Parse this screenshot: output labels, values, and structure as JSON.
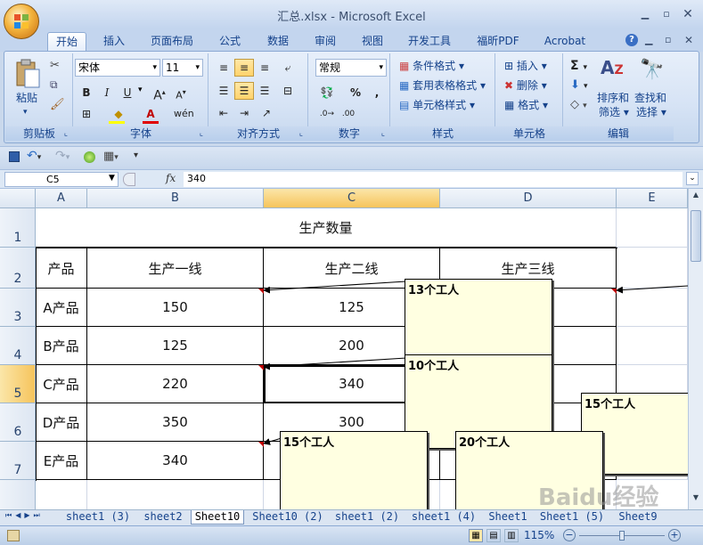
{
  "window": {
    "title": "汇总.xlsx - Microsoft Excel"
  },
  "ribbon_tabs": [
    "开始",
    "插入",
    "页面布局",
    "公式",
    "数据",
    "审阅",
    "视图",
    "开发工具",
    "福昕PDF",
    "Acrobat"
  ],
  "clipboard": {
    "paste": "粘贴",
    "label": "剪贴板"
  },
  "font": {
    "name": "宋体",
    "size": "11",
    "label": "字体"
  },
  "alignment": {
    "label": "对齐方式"
  },
  "number": {
    "format": "常规",
    "label": "数字"
  },
  "styles": {
    "conditional": "条件格式",
    "table": "套用表格格式",
    "cell": "单元格样式",
    "label": "样式"
  },
  "cells": {
    "insert": "插入",
    "delete": "删除",
    "format": "格式",
    "label": "单元格"
  },
  "editing": {
    "sort": "排序和",
    "filter": "筛选",
    "find": "查找和",
    "select": "选择",
    "label": "编辑"
  },
  "formula_bar": {
    "name_box": "C5",
    "fx": "fx",
    "value": "340"
  },
  "columns": [
    "A",
    "B",
    "C",
    "D",
    "E"
  ],
  "rows": [
    "1",
    "2",
    "3",
    "4",
    "5",
    "6",
    "7"
  ],
  "sheet": {
    "title": "生产数量",
    "headers": [
      "产品",
      "生产一线",
      "生产二线",
      "生产三线"
    ],
    "data": [
      [
        "A产品",
        "150",
        "125"
      ],
      [
        "B产品",
        "125",
        "200"
      ],
      [
        "C产品",
        "220",
        "340"
      ],
      [
        "D产品",
        "350",
        "300"
      ],
      [
        "E产品",
        "340",
        ""
      ]
    ]
  },
  "comments": [
    "13个工人",
    "10个工人",
    "15个工人",
    "15个工人",
    "20个工人"
  ],
  "sheet_tabs": [
    "sheet1 (3)",
    "sheet2",
    "Sheet10",
    "Sheet10 (2)",
    "sheet1 (2)",
    "sheet1 (4)",
    "Sheet1",
    "Sheet1 (5)",
    "Sheet9"
  ],
  "status": {
    "zoom": "115%"
  },
  "watermark": "Baidu经验"
}
